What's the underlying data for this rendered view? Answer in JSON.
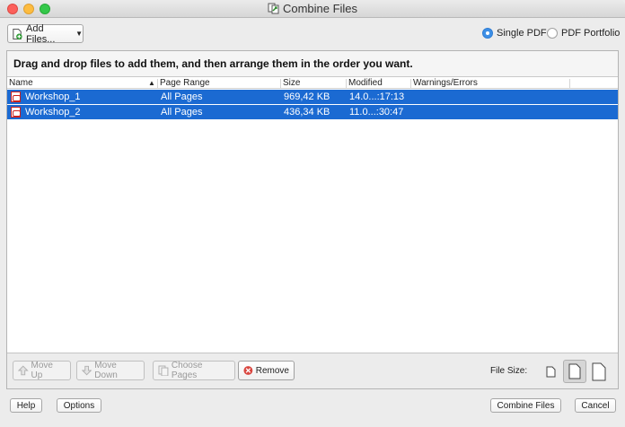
{
  "window": {
    "title": "Combine Files"
  },
  "toolbar": {
    "add_files_label": "Add Files...",
    "options": [
      {
        "label": "Single PDF",
        "selected": true
      },
      {
        "label": "PDF Portfolio",
        "selected": false
      }
    ]
  },
  "instruction": "Drag and drop files to add them, and then arrange them in the order you want.",
  "table": {
    "columns": [
      "Name",
      "Page Range",
      "Size",
      "Modified",
      "Warnings/Errors"
    ],
    "rows": [
      {
        "name": "Workshop_1",
        "page_range": "All Pages",
        "size": "969,42 KB",
        "modified": "14.0...:17:13",
        "warnings": ""
      },
      {
        "name": "Workshop_2",
        "page_range": "All Pages",
        "size": "436,34 KB",
        "modified": "11.0...:30:47",
        "warnings": ""
      }
    ]
  },
  "actions": {
    "move_up": "Move Up",
    "move_down": "Move Down",
    "choose_pages": "Choose Pages",
    "remove": "Remove"
  },
  "file_size_label": "File Size:",
  "footer": {
    "help": "Help",
    "options": "Options",
    "combine": "Combine Files",
    "cancel": "Cancel"
  },
  "colors": {
    "selection": "#1b6ad2",
    "radio_on": "#3d8fe6",
    "pdf_red": "#c8201c"
  }
}
